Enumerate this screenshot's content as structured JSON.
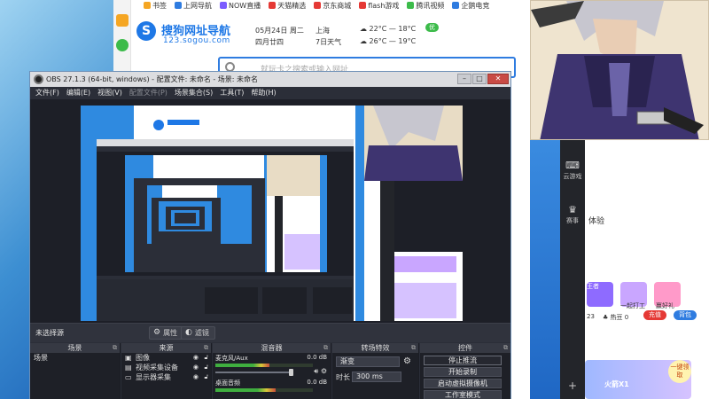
{
  "browser": {
    "bookmarks": [
      "书签",
      "上网导航",
      "NOW直播",
      "天猫精选",
      "京东商城",
      "flash游戏",
      "腾讯视频",
      "企鹅电竞"
    ],
    "bookmark_colors": [
      "#f5a623",
      "#2f7ce0",
      "#7b5cff",
      "#e53935",
      "#e53935",
      "#e53935",
      "#3cbb4a",
      "#2f7ce0"
    ],
    "logo_glyph": "S",
    "site_name": "搜狗网址导航",
    "site_url": "123.sogou.com",
    "date_line1": "05月24日 周二",
    "date_line2": "四月廿四",
    "city": "上海",
    "city_sub": "7日天气",
    "weather_line1": "☁ 22°C — 18°C",
    "weather_line2": "☁ 26°C — 19°C",
    "air_quality": "优",
    "search_placeholder": "就玩卡之搜索或输入网址"
  },
  "right_app": {
    "rail": [
      {
        "icon": "gamepad-icon",
        "glyph": "⌨",
        "label": "云游戏"
      },
      {
        "icon": "trophy-icon",
        "glyph": "♛",
        "label": "赛事"
      }
    ],
    "add_glyph": "+",
    "experience_label": "体验",
    "promos": [
      "王者",
      "一起打工",
      "赢好礼"
    ],
    "stats_left": "23",
    "stats_mid": "♣ 热豆 0",
    "pill1": "充值",
    "pill2": "背包",
    "banner_badge": "一键领取",
    "banner_text": "火箭X1",
    "headset_glyph": "🎧"
  },
  "obs": {
    "title": "OBS 27.1.3 (64-bit, windows) - 配置文件: 未命名 - 场景: 未命名",
    "menu": [
      "文件(F)",
      "编辑(E)",
      "视图(V)",
      "配置文件(P)",
      "场景集合(S)",
      "工具(T)",
      "帮助(H)"
    ],
    "no_source": "未选择源",
    "props_label": "属性",
    "filters_label": "滤镜",
    "docks": {
      "scenes_title": "场景",
      "sources_title": "来源",
      "mixer_title": "混音器",
      "transitions_title": "转场特效",
      "controls_title": "控件"
    },
    "scenes": [
      "场景"
    ],
    "sources": [
      {
        "icon": "image-icon",
        "glyph": "▣",
        "name": "图像"
      },
      {
        "icon": "camera-icon",
        "glyph": "▤",
        "name": "视频采集设备"
      },
      {
        "icon": "monitor-icon",
        "glyph": "▭",
        "name": "显示器采集"
      }
    ],
    "mixer": [
      {
        "name": "麦克风/Aux",
        "db": "0.0 dB",
        "level": 0.55
      },
      {
        "name": "桌面音频",
        "db": "0.0 dB",
        "level": 0.62
      }
    ],
    "transition": {
      "type": "渐变",
      "duration_label": "时长",
      "duration": "300 ms"
    },
    "controls": [
      "停止推流",
      "开始录制",
      "启动虚拟摄像机",
      "工作室模式"
    ]
  }
}
